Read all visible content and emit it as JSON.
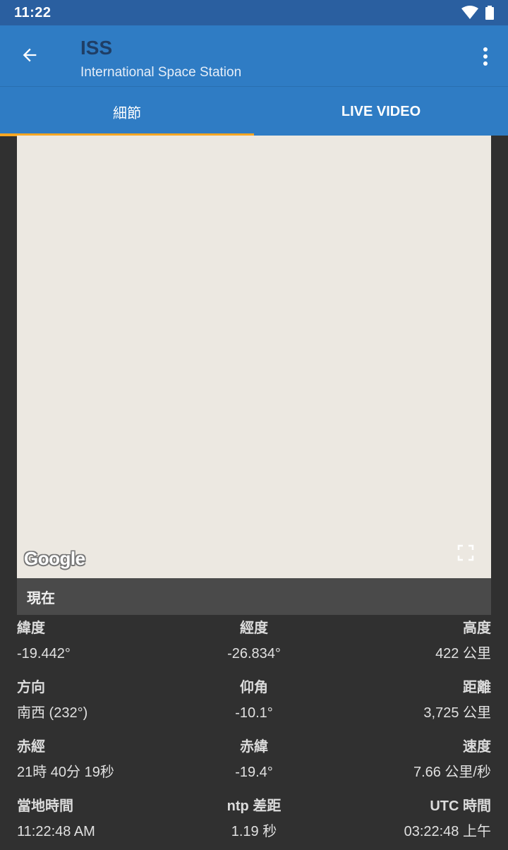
{
  "status_bar": {
    "time": "11:22",
    "icons": [
      "wifi-icon",
      "battery-icon"
    ]
  },
  "app_bar": {
    "title": "ISS",
    "subtitle": "International Space Station"
  },
  "tabs": [
    {
      "label": "細節",
      "active": true
    },
    {
      "label": "LIVE VIDEO",
      "active": false
    }
  ],
  "map": {
    "logo_text": "Google"
  },
  "section": {
    "title": "現在"
  },
  "details": [
    [
      {
        "label": "緯度",
        "value": "-19.442°"
      },
      {
        "label": "經度",
        "value": "-26.834°"
      },
      {
        "label": "高度",
        "value": "422 公里"
      }
    ],
    [
      {
        "label": "方向",
        "value": "南西 (232°)"
      },
      {
        "label": "仰角",
        "value": "-10.1°"
      },
      {
        "label": "距離",
        "value": "3,725 公里"
      }
    ],
    [
      {
        "label": "赤經",
        "value": "21時 40分 19秒"
      },
      {
        "label": "赤緯",
        "value": "-19.4°"
      },
      {
        "label": "速度",
        "value": "7.66 公里/秒"
      }
    ],
    [
      {
        "label": "當地時間",
        "value": "11:22:48 AM"
      },
      {
        "label": "ntp 差距",
        "value": "1.19 秒"
      },
      {
        "label": "UTC 時間",
        "value": "03:22:48 上午"
      }
    ]
  ],
  "colors": {
    "status_bar": "#2a5fa0",
    "app_bar": "#2f7cc4",
    "tab_indicator": "#f5a623",
    "background": "#303030",
    "map": "#ece8e1"
  }
}
